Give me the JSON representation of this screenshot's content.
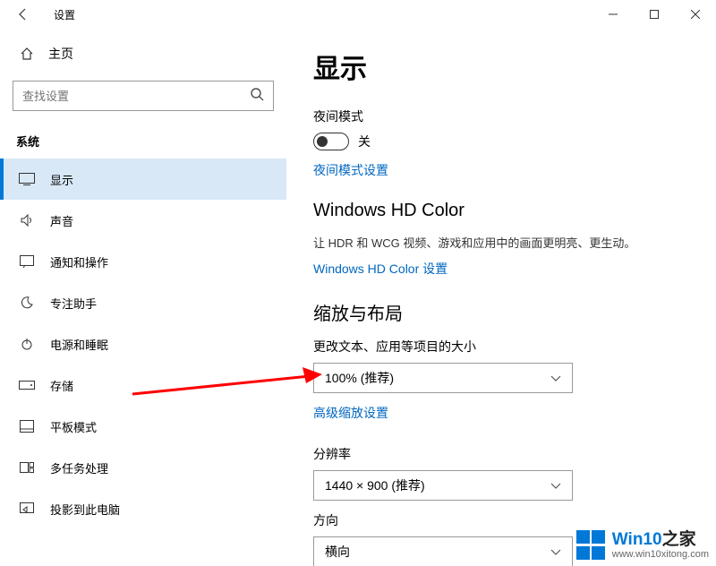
{
  "titlebar": {
    "title": "设置"
  },
  "sidebar": {
    "home": "主页",
    "search_placeholder": "查找设置",
    "section": "系统",
    "items": [
      {
        "label": "显示"
      },
      {
        "label": "声音"
      },
      {
        "label": "通知和操作"
      },
      {
        "label": "专注助手"
      },
      {
        "label": "电源和睡眠"
      },
      {
        "label": "存储"
      },
      {
        "label": "平板模式"
      },
      {
        "label": "多任务处理"
      },
      {
        "label": "投影到此电脑"
      }
    ]
  },
  "main": {
    "heading": "显示",
    "night_mode_label": "夜间模式",
    "night_mode_state": "关",
    "night_mode_link": "夜间模式设置",
    "hd_heading": "Windows HD Color",
    "hd_desc": "让 HDR 和 WCG 视频、游戏和应用中的画面更明亮、更生动。",
    "hd_link": "Windows HD Color 设置",
    "scale_heading": "缩放与布局",
    "scale_label": "更改文本、应用等项目的大小",
    "scale_value": "100% (推荐)",
    "scale_link": "高级缩放设置",
    "res_label": "分辨率",
    "res_value": "1440 × 900 (推荐)",
    "orient_label": "方向",
    "orient_value": "横向"
  },
  "watermark": {
    "brand1": "Win10",
    "brand2": "之家",
    "url": "www.win10xitong.com"
  }
}
